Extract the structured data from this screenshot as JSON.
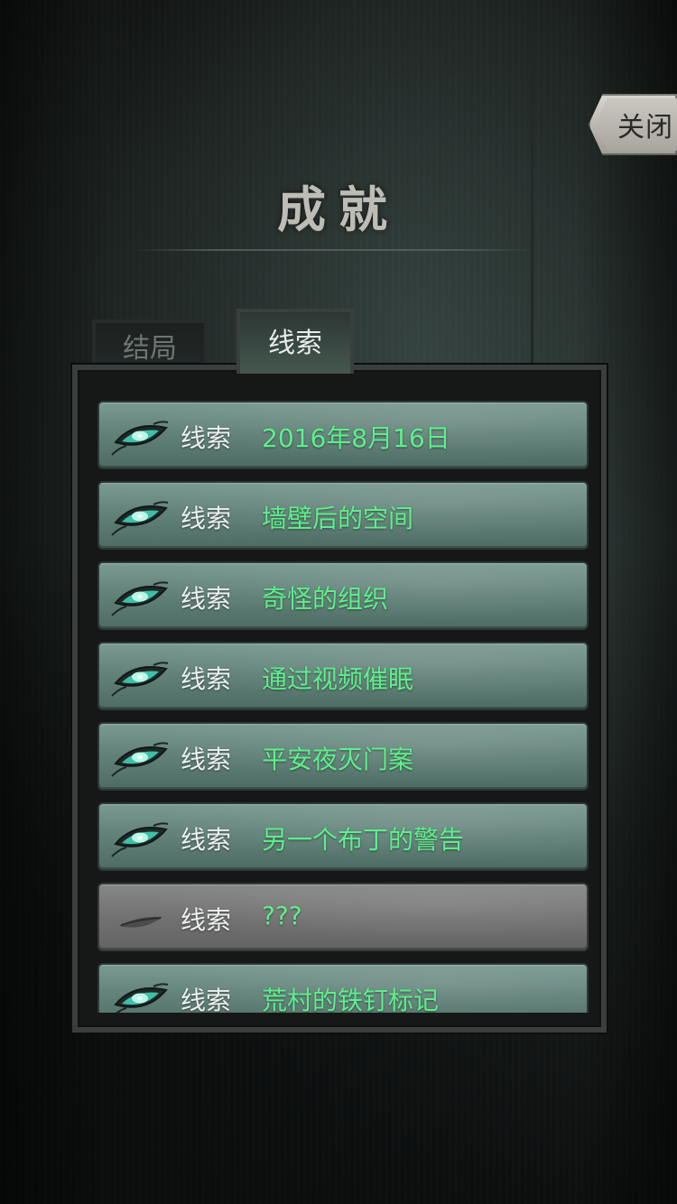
{
  "close_label": "关闭",
  "title": "成就",
  "tabs": {
    "endings": "结局",
    "clues": "线索"
  },
  "colors": {
    "clue_name": "#5cf08a",
    "row_unlocked": "#62827a",
    "row_locked": "#727272"
  },
  "items": [
    {
      "label": "线索",
      "name": "2016年8月16日",
      "locked": false,
      "icon": "green-eye-icon"
    },
    {
      "label": "线索",
      "name": "墙壁后的空间",
      "locked": false,
      "icon": "green-eye-icon"
    },
    {
      "label": "线索",
      "name": "奇怪的组织",
      "locked": false,
      "icon": "green-eye-icon"
    },
    {
      "label": "线索",
      "name": "通过视频催眠",
      "locked": false,
      "icon": "green-eye-icon"
    },
    {
      "label": "线索",
      "name": "平安夜灭门案",
      "locked": false,
      "icon": "green-eye-icon"
    },
    {
      "label": "线索",
      "name": "另一个布丁的警告",
      "locked": false,
      "icon": "green-eye-icon"
    },
    {
      "label": "线索",
      "name": "???",
      "locked": true,
      "icon": "closed-eye-icon"
    },
    {
      "label": "线索",
      "name": "荒村的铁钉标记",
      "locked": false,
      "icon": "green-eye-icon"
    }
  ]
}
